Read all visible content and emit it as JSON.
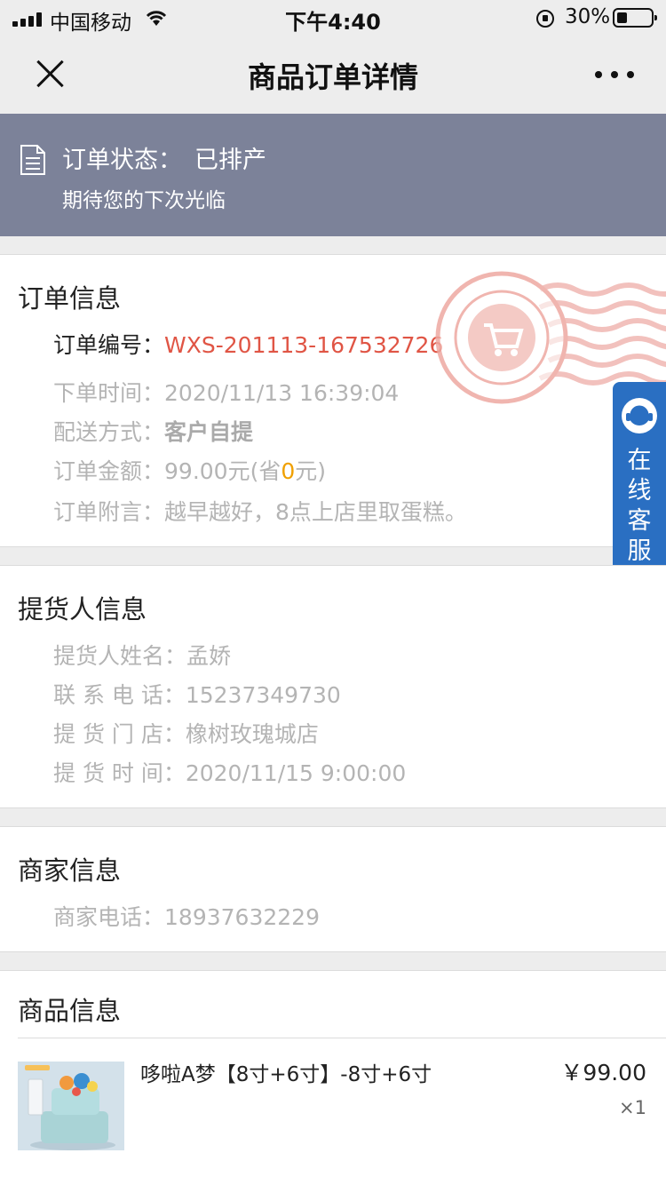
{
  "status_bar": {
    "carrier": "中国移动",
    "time": "下午4:40",
    "battery_pct": "30%",
    "battery_level": 0.3
  },
  "nav": {
    "title": "商品订单详情"
  },
  "status_banner": {
    "label": "订单状态：",
    "value": "已排产",
    "subtitle": "期待您的下次光临"
  },
  "order_info": {
    "title": "订单信息",
    "number_label": "订单编号：",
    "number_value": "WXS-201113-167532726",
    "time_label": "下单时间：",
    "time_value": "2020/11/13 16:39:04",
    "delivery_label": "配送方式：",
    "delivery_value": "客户自提",
    "amount_label": "订单金额：",
    "amount_prefix": "99.00元(省",
    "amount_saved": "0",
    "amount_suffix": "元)",
    "note_label": "订单附言：",
    "note_value": "越早越好，8点上店里取蛋糕。"
  },
  "pickup_info": {
    "title": "提货人信息",
    "name_label": "提货人姓名：",
    "name_value": "孟娇",
    "phone_label": "联 系 电 话：",
    "phone_value": "15237349730",
    "store_label": "提 货 门 店：",
    "store_value": "橡树玫瑰城店",
    "time_label": "提 货 时 间：",
    "time_value": "2020/11/15 9:00:00"
  },
  "merchant_info": {
    "title": "商家信息",
    "phone_label": "商家电话：",
    "phone_value": "18937632229"
  },
  "product_info": {
    "title": "商品信息",
    "items": [
      {
        "name": "哆啦A梦【8寸+6寸】-8寸+6寸",
        "price": "￥99.00",
        "qty": "×1"
      }
    ]
  },
  "service_tab": {
    "label": "在线客服"
  },
  "colors": {
    "banner": "#7c8299",
    "order_number": "#e05545",
    "saved_amount": "#f0a000",
    "service_tab": "#2a6fc2"
  },
  "icons": {
    "nav_close": "close-icon",
    "nav_more": "more-icon",
    "banner": "document-icon",
    "service": "customer-service-icon",
    "stamp": "added-to-collection-stamp"
  }
}
